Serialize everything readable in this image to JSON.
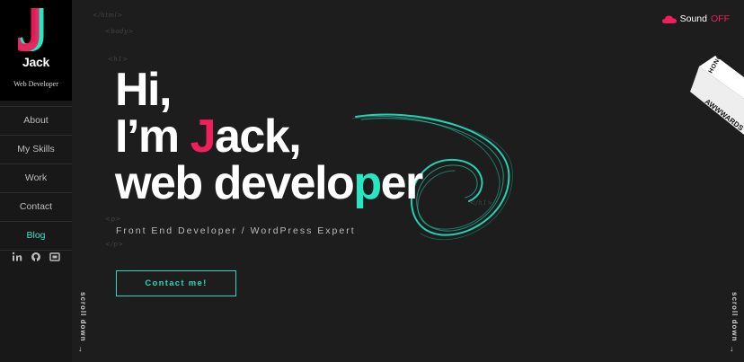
{
  "sidebar": {
    "logo": {
      "letter": "J",
      "name": "Jack",
      "role": "Web Developer"
    },
    "nav": [
      {
        "label": "About",
        "active": false
      },
      {
        "label": "My Skills",
        "active": false
      },
      {
        "label": "Work",
        "active": false
      },
      {
        "label": "Contact",
        "active": false
      },
      {
        "label": "Blog",
        "active": true
      }
    ],
    "social": [
      "linkedin-icon",
      "github-icon",
      "codepen-icon"
    ]
  },
  "code_tags": {
    "html": "</html>",
    "body": "<body>",
    "h1_open": "<h1>",
    "h1_close": "</h1>",
    "p_open": "<p>",
    "p_close": "</p>"
  },
  "hero": {
    "line1": "Hi,",
    "line2_prefix": "I’m ",
    "line2_highlight": "J",
    "line2_suffix": "ack,",
    "line3_prefix": "web develo",
    "line3_highlight": "p",
    "line3_suffix": "er",
    "subtitle": "Front End Developer / WordPress Expert",
    "cta": "Contact me!"
  },
  "sound": {
    "label": "Sound",
    "state": "OFF"
  },
  "awards": {
    "top": "HONORS",
    "bottom": "AWWWARDS"
  },
  "scroll": {
    "label": "scroll down",
    "arrow": "↓"
  },
  "colors": {
    "accent_pink": "#ee1f5b",
    "accent_teal": "#27e6c3",
    "background": "#1d1d1d"
  }
}
